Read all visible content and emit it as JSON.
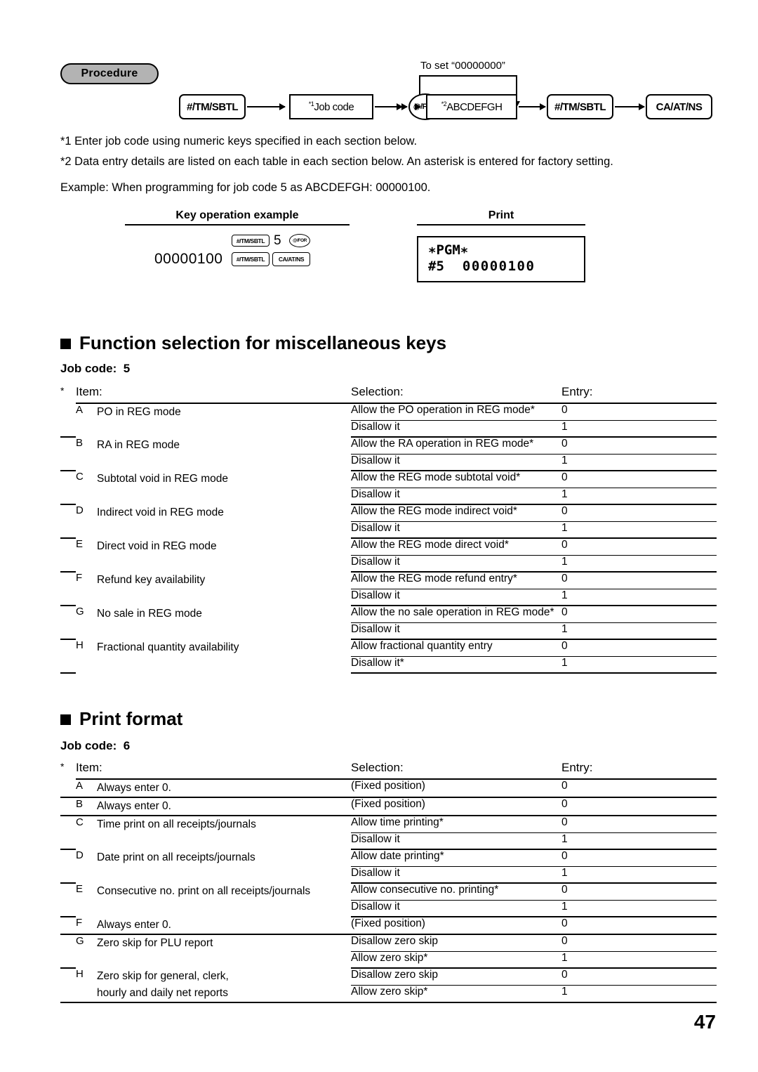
{
  "procedure": {
    "badge_label": "Procedure",
    "bypass_label": "To set “00000000”",
    "keys": [
      {
        "label": "#/TM/SBTL",
        "shape": "round"
      },
      {
        "label": "Job code",
        "shape": "square",
        "superscript": "*1"
      },
      {
        "label": "@/FOR",
        "shape": "ellipse"
      },
      {
        "label": "ABCDEFGH",
        "shape": "square",
        "superscript": "*2"
      },
      {
        "label": "#/TM/SBTL",
        "shape": "round"
      },
      {
        "label": "CA/AT/NS",
        "shape": "round"
      }
    ]
  },
  "notes": [
    "*1  Enter job code using numeric keys specified in each section below.",
    "*2  Data entry details are listed on each table in each section below.  An asterisk is entered for factory setting."
  ],
  "example": {
    "line": "Example:  When programming for job code 5 as ABCDEFGH: 00000100.",
    "key_operation_header": "Key operation example",
    "print_header": "Print",
    "key_operation": {
      "row1": [
        {
          "label": "#/TM/SBTL",
          "shape": "round"
        },
        {
          "label": "5",
          "shape": "text"
        },
        {
          "label": "@/FOR",
          "shape": "ellipse"
        }
      ],
      "row2_value": "00000100",
      "row2": [
        {
          "label": "#/TM/SBTL",
          "shape": "round"
        },
        {
          "label": "CA/AT/NS",
          "shape": "round"
        }
      ]
    },
    "print": {
      "line1": "∗PGM∗",
      "line2_label": "#5",
      "line2_value": "00000100"
    }
  },
  "sections": [
    {
      "title": "Function selection for miscellaneous keys",
      "job_code_label": "Job code:",
      "job_code_value": "5",
      "table": {
        "asterisk": "*",
        "headers": {
          "item": "Item:",
          "selection": "Selection:",
          "entry": "Entry:"
        },
        "rows": [
          {
            "letter": "A",
            "item": [
              "PO in REG mode"
            ],
            "options": [
              {
                "selection": "Allow the PO operation in REG mode*",
                "entry": "0"
              },
              {
                "selection": "Disallow it",
                "entry": "1"
              }
            ]
          },
          {
            "letter": "B",
            "item": [
              "RA in REG mode"
            ],
            "options": [
              {
                "selection": "Allow the RA operation in REG mode*",
                "entry": "0"
              },
              {
                "selection": "Disallow it",
                "entry": "1"
              }
            ]
          },
          {
            "letter": "C",
            "item": [
              "Subtotal void in REG mode"
            ],
            "options": [
              {
                "selection": "Allow the REG mode subtotal void*",
                "entry": "0"
              },
              {
                "selection": "Disallow it",
                "entry": "1"
              }
            ]
          },
          {
            "letter": "D",
            "item": [
              "Indirect void in REG mode"
            ],
            "options": [
              {
                "selection": "Allow the REG mode indirect void*",
                "entry": "0"
              },
              {
                "selection": "Disallow it",
                "entry": "1"
              }
            ]
          },
          {
            "letter": "E",
            "item": [
              "Direct void in REG mode"
            ],
            "options": [
              {
                "selection": "Allow the REG mode direct void*",
                "entry": "0"
              },
              {
                "selection": "Disallow it",
                "entry": "1"
              }
            ]
          },
          {
            "letter": "F",
            "item": [
              "Refund key availability"
            ],
            "options": [
              {
                "selection": "Allow the REG mode refund entry*",
                "entry": "0"
              },
              {
                "selection": "Disallow it",
                "entry": "1"
              }
            ]
          },
          {
            "letter": "G",
            "item": [
              "No sale in REG mode"
            ],
            "options": [
              {
                "selection": "Allow the no sale operation in REG mode*",
                "entry": "0"
              },
              {
                "selection": "Disallow it",
                "entry": "1"
              }
            ]
          },
          {
            "letter": "H",
            "item": [
              "Fractional quantity availability"
            ],
            "options": [
              {
                "selection": "Allow fractional quantity entry",
                "entry": "0"
              },
              {
                "selection": "Disallow it*",
                "entry": "1"
              }
            ]
          }
        ]
      }
    },
    {
      "title": "Print format",
      "job_code_label": "Job code:",
      "job_code_value": "6",
      "table": {
        "asterisk": "*",
        "headers": {
          "item": "Item:",
          "selection": "Selection:",
          "entry": "Entry:"
        },
        "rows": [
          {
            "letter": "A",
            "item": [
              "Always enter 0."
            ],
            "options": [
              {
                "selection": "(Fixed position)",
                "entry": "0"
              }
            ]
          },
          {
            "letter": "B",
            "item": [
              "Always enter 0."
            ],
            "options": [
              {
                "selection": "(Fixed position)",
                "entry": "0"
              }
            ]
          },
          {
            "letter": "C",
            "item": [
              "Time print on all receipts/journals"
            ],
            "options": [
              {
                "selection": "Allow time printing*",
                "entry": "0"
              },
              {
                "selection": "Disallow it",
                "entry": "1"
              }
            ]
          },
          {
            "letter": "D",
            "item": [
              "Date print on all receipts/journals"
            ],
            "options": [
              {
                "selection": "Allow date printing*",
                "entry": "0"
              },
              {
                "selection": "Disallow it",
                "entry": "1"
              }
            ]
          },
          {
            "letter": "E",
            "item": [
              "Consecutive no. print on all receipts/journals"
            ],
            "options": [
              {
                "selection": "Allow consecutive no. printing*",
                "entry": "0"
              },
              {
                "selection": "Disallow it",
                "entry": "1"
              }
            ]
          },
          {
            "letter": "F",
            "item": [
              "Always enter 0."
            ],
            "options": [
              {
                "selection": "(Fixed position)",
                "entry": "0"
              }
            ]
          },
          {
            "letter": "G",
            "item": [
              "Zero skip for PLU report"
            ],
            "options": [
              {
                "selection": "Disallow zero skip",
                "entry": "0"
              },
              {
                "selection": "Allow zero skip*",
                "entry": "1"
              }
            ]
          },
          {
            "letter": "H",
            "item": [
              "Zero skip for general, clerk,",
              "hourly and daily net reports"
            ],
            "options": [
              {
                "selection": "Disallow zero skip",
                "entry": "0"
              },
              {
                "selection": "Allow zero skip*",
                "entry": "1"
              }
            ]
          }
        ]
      }
    }
  ],
  "page_number": "47"
}
